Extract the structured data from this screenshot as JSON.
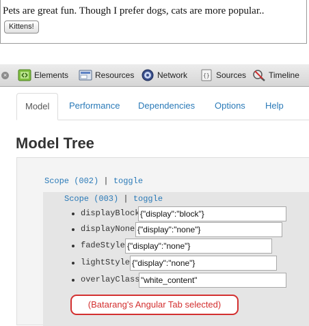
{
  "preview": {
    "text": "Pets are great fun. Though I prefer dogs, cats are more popular..",
    "button_label": "Kittens!"
  },
  "devtools": {
    "tabs": [
      {
        "label": "Elements",
        "icon": "elements-icon"
      },
      {
        "label": "Resources",
        "icon": "resources-icon"
      },
      {
        "label": "Network",
        "icon": "network-icon"
      },
      {
        "label": "Sources",
        "icon": "sources-icon"
      },
      {
        "label": "Timeline",
        "icon": "timeline-icon"
      }
    ]
  },
  "batarang": {
    "tabs": [
      "Model",
      "Performance",
      "Dependencies",
      "Options",
      "Help"
    ],
    "active_tab": "Model",
    "title": "Model Tree",
    "outer_scope": {
      "label": "Scope (002)",
      "sep": "|",
      "toggle": "toggle"
    },
    "inner_scope": {
      "label": "Scope (003)",
      "sep": "|",
      "toggle": "toggle"
    },
    "properties": [
      {
        "key": "displayBlock",
        "value": "{\"display\":\"block\"}"
      },
      {
        "key": "displayNone",
        "value": "{\"display\":\"none\"}"
      },
      {
        "key": "fadeStyle",
        "value": "{\"display\":\"none\"}"
      },
      {
        "key": "lightStyle",
        "value": "{\"display\":\"none\"}"
      },
      {
        "key": "overlayClass",
        "value": "\"white_content\""
      }
    ]
  },
  "annotation": "(Batarang's Angular Tab selected)",
  "colors": {
    "link": "#2a7ab8",
    "annotation": "#d32f2f"
  }
}
